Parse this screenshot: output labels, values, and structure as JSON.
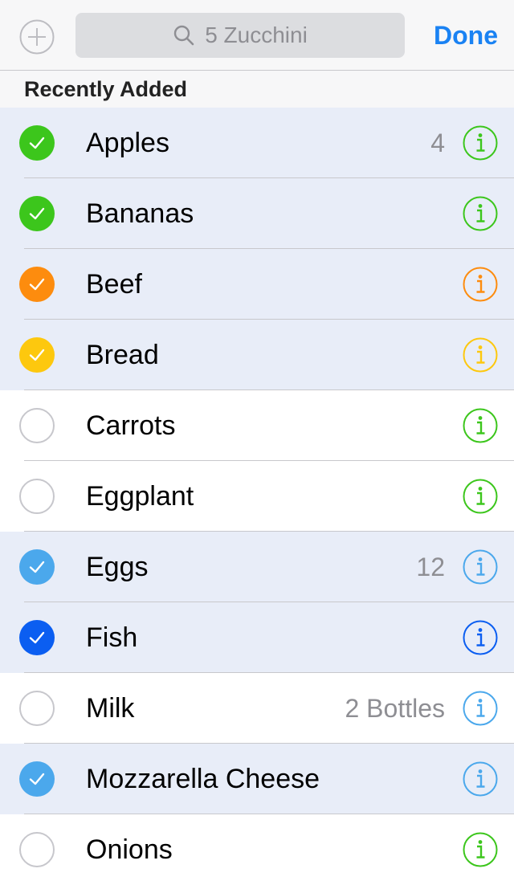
{
  "toolbar": {
    "search_value": "5 Zucchini",
    "done_label": "Done"
  },
  "section": {
    "title": "Recently Added"
  },
  "colors": {
    "accent": "#1a82f3",
    "checked_row_bg": "#e8edf8"
  },
  "items": [
    {
      "label": "Apples",
      "quantity": "4",
      "checked": true,
      "check_color": "#3cc61c",
      "info_color": "#3cc61c"
    },
    {
      "label": "Bananas",
      "quantity": "",
      "checked": true,
      "check_color": "#3cc61c",
      "info_color": "#3cc61c"
    },
    {
      "label": "Beef",
      "quantity": "",
      "checked": true,
      "check_color": "#fd8c0e",
      "info_color": "#fd8c0e"
    },
    {
      "label": "Bread",
      "quantity": "",
      "checked": true,
      "check_color": "#fdc80e",
      "info_color": "#fdc80e"
    },
    {
      "label": "Carrots",
      "quantity": "",
      "checked": false,
      "check_color": "#3cc61c",
      "info_color": "#3cc61c"
    },
    {
      "label": "Eggplant",
      "quantity": "",
      "checked": false,
      "check_color": "#3cc61c",
      "info_color": "#3cc61c"
    },
    {
      "label": "Eggs",
      "quantity": "12",
      "checked": true,
      "check_color": "#4ba8ec",
      "info_color": "#4ba8ec"
    },
    {
      "label": "Fish",
      "quantity": "",
      "checked": true,
      "check_color": "#0b5ef1",
      "info_color": "#0b5ef1"
    },
    {
      "label": "Milk",
      "quantity": "2 Bottles",
      "checked": false,
      "check_color": "#4ba8ec",
      "info_color": "#4ba8ec"
    },
    {
      "label": "Mozzarella Cheese",
      "quantity": "",
      "checked": true,
      "check_color": "#4ba8ec",
      "info_color": "#4ba8ec"
    },
    {
      "label": "Onions",
      "quantity": "",
      "checked": false,
      "check_color": "#3cc61c",
      "info_color": "#3cc61c"
    }
  ]
}
